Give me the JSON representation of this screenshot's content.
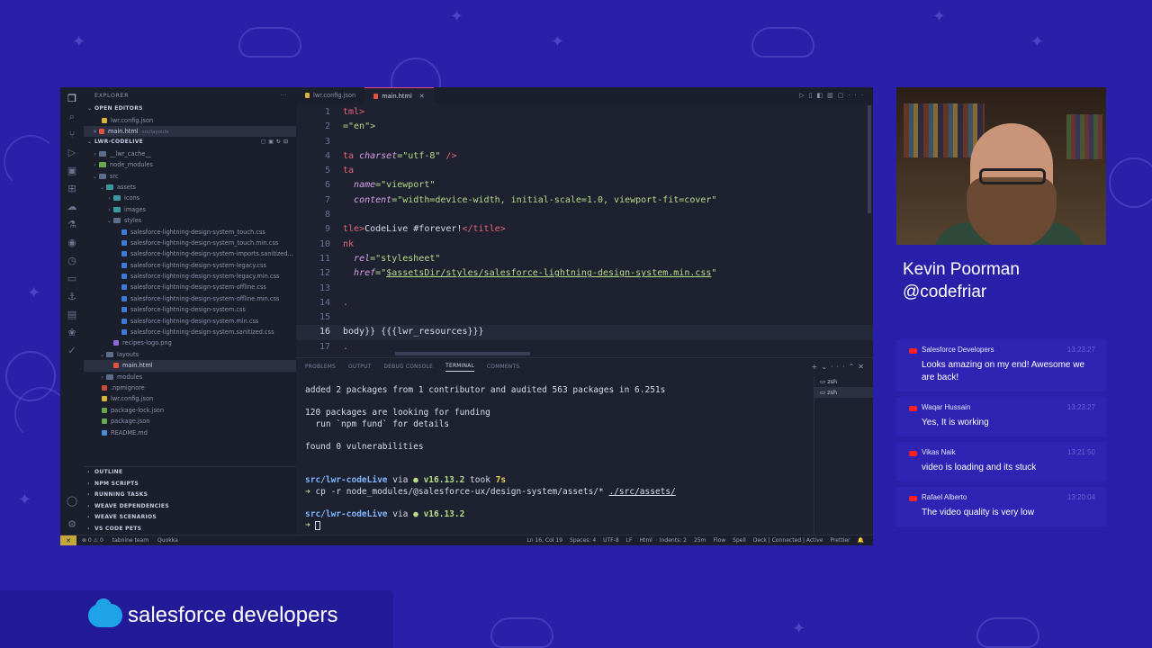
{
  "explorer": {
    "title": "EXPLORER",
    "open_editors_label": "OPEN EDITORS",
    "open_editors": [
      {
        "name": "lwr.config.json",
        "path": ""
      },
      {
        "name": "main.html",
        "path": "src/layouts"
      }
    ],
    "project_label": "LWR-CODELIVE",
    "tree": [
      "__lwr_cache__",
      "node_modules",
      "src",
      "assets",
      "icons",
      "images",
      "styles",
      "salesforce-lightning-design-system_touch.css",
      "salesforce-lightning-design-system_touch.min.css",
      "salesforce-lightning-design-system-imports.sanitized...",
      "salesforce-lightning-design-system-legacy.css",
      "salesforce-lightning-design-system-legacy.min.css",
      "salesforce-lightning-design-system-offline.css",
      "salesforce-lightning-design-system-offline.min.css",
      "salesforce-lightning-design-system.css",
      "salesforce-lightning-design-system.min.css",
      "salesforce-lightning-design-system.sanitized.css",
      "recipes-logo.png",
      "layouts",
      "main.html",
      "modules",
      ".npmignore",
      "lwr.config.json",
      "package-lock.json",
      "package.json",
      "README.md"
    ],
    "bottom_sections": [
      "OUTLINE",
      "NPM SCRIPTS",
      "RUNNING TASKS",
      "WEAVE DEPENDENCIES",
      "WEAVE SCENARIOS",
      "VS CODE PETS"
    ]
  },
  "editor": {
    "tabs": [
      {
        "label": "lwr.config.json"
      },
      {
        "label": "main.html"
      }
    ],
    "line_numbers": [
      "1",
      "2",
      "3",
      "4",
      "5",
      "6",
      "7",
      "8",
      "9",
      "10",
      "11",
      "12",
      "13",
      "14",
      "15",
      "16",
      "17"
    ],
    "lines": {
      "l1": "tml>",
      "l2a": "=\"en\">",
      "l4_tag": "ta",
      "l4_attr": "charset",
      "l4_val": "=\"utf-8\"",
      "l4_end": " />",
      "l5": "ta",
      "l6_attr": "name",
      "l6_val": "=\"viewport\"",
      "l7_attr": "content",
      "l7_val": "=\"width=device-width, initial-scale=1.0, viewport-fit=cover\"",
      "l9_tag1": "tle>",
      "l9_text": "CodeLive #forever!",
      "l9_tag2": "</title>",
      "l10": "nk",
      "l11_attr": "rel",
      "l11_val": "=\"stylesheet\"",
      "l12_attr": "href",
      "l12_val_pre": "=\"",
      "l12_val_link": "$assetsDir/styles/salesforce-lightning-design-system.min.css",
      "l12_val_post": "\"",
      "l14": ".",
      "l16_a": "body}}",
      "l16_b": " {{{lwr_resources}}}",
      "l17": "."
    }
  },
  "panel": {
    "tabs": [
      "PROBLEMS",
      "OUTPUT",
      "DEBUG CONSOLE",
      "TERMINAL",
      "COMMENTS"
    ],
    "terminal": {
      "line1": "added 2 packages from 1 contributor and audited 563 packages in 6.251s",
      "line2": "120 packages are looking for funding",
      "line3": "  run `npm fund` for details",
      "line4": "found 0 vulnerabilities",
      "prompt_dir": "src/lwr-codeLive",
      "via": " via ",
      "node": "● v16.13.2",
      "took": " took ",
      "took_time": "7s",
      "cmd_prefix": "➜ ",
      "cmd": "cp -r node_modules/@salesforce-ux/design-system/assets/* ",
      "cmd_dest": "./src/assets/",
      "prompt2_arrow": "➜ "
    },
    "terminal_list": [
      "zsh",
      "zsh"
    ]
  },
  "status_bar": {
    "remote": "✕",
    "problems": "⊗ 0 ⚠ 0",
    "tabnine": "tabnine team",
    "quokka": "Quokka",
    "position": "Ln 16, Col 19",
    "spaces": "Spaces: 4",
    "encoding": "UTF-8",
    "eol": "LF",
    "language": "Html",
    "indents": "Indents: 2",
    "timer": "25m",
    "flow": "Flow",
    "spell": "Spell",
    "deck": "Deck | Connected | Active",
    "prettier": "Prettier"
  },
  "presenter": {
    "name": "Kevin Poorman",
    "handle": "@codefriar"
  },
  "chat": [
    {
      "author": "Salesforce Developers",
      "time": "13:23:27",
      "text": "Looks amazing on my end! Awesome we are back!"
    },
    {
      "author": "Waqar Hussain",
      "time": "13:23:27",
      "text": "Yes, It is working"
    },
    {
      "author": "Vikas Naik",
      "time": "13:21:50",
      "text": "video is loading and its stuck"
    },
    {
      "author": "Rafael Alberto",
      "time": "13:20:04",
      "text": "The video quality is very low"
    }
  ],
  "brand": {
    "word1": "salesforce",
    "word2": " developers"
  },
  "colors": {
    "background": "#2a1fa8",
    "chat_card": "#2e23b3",
    "accent_pink": "#e04a8a"
  }
}
